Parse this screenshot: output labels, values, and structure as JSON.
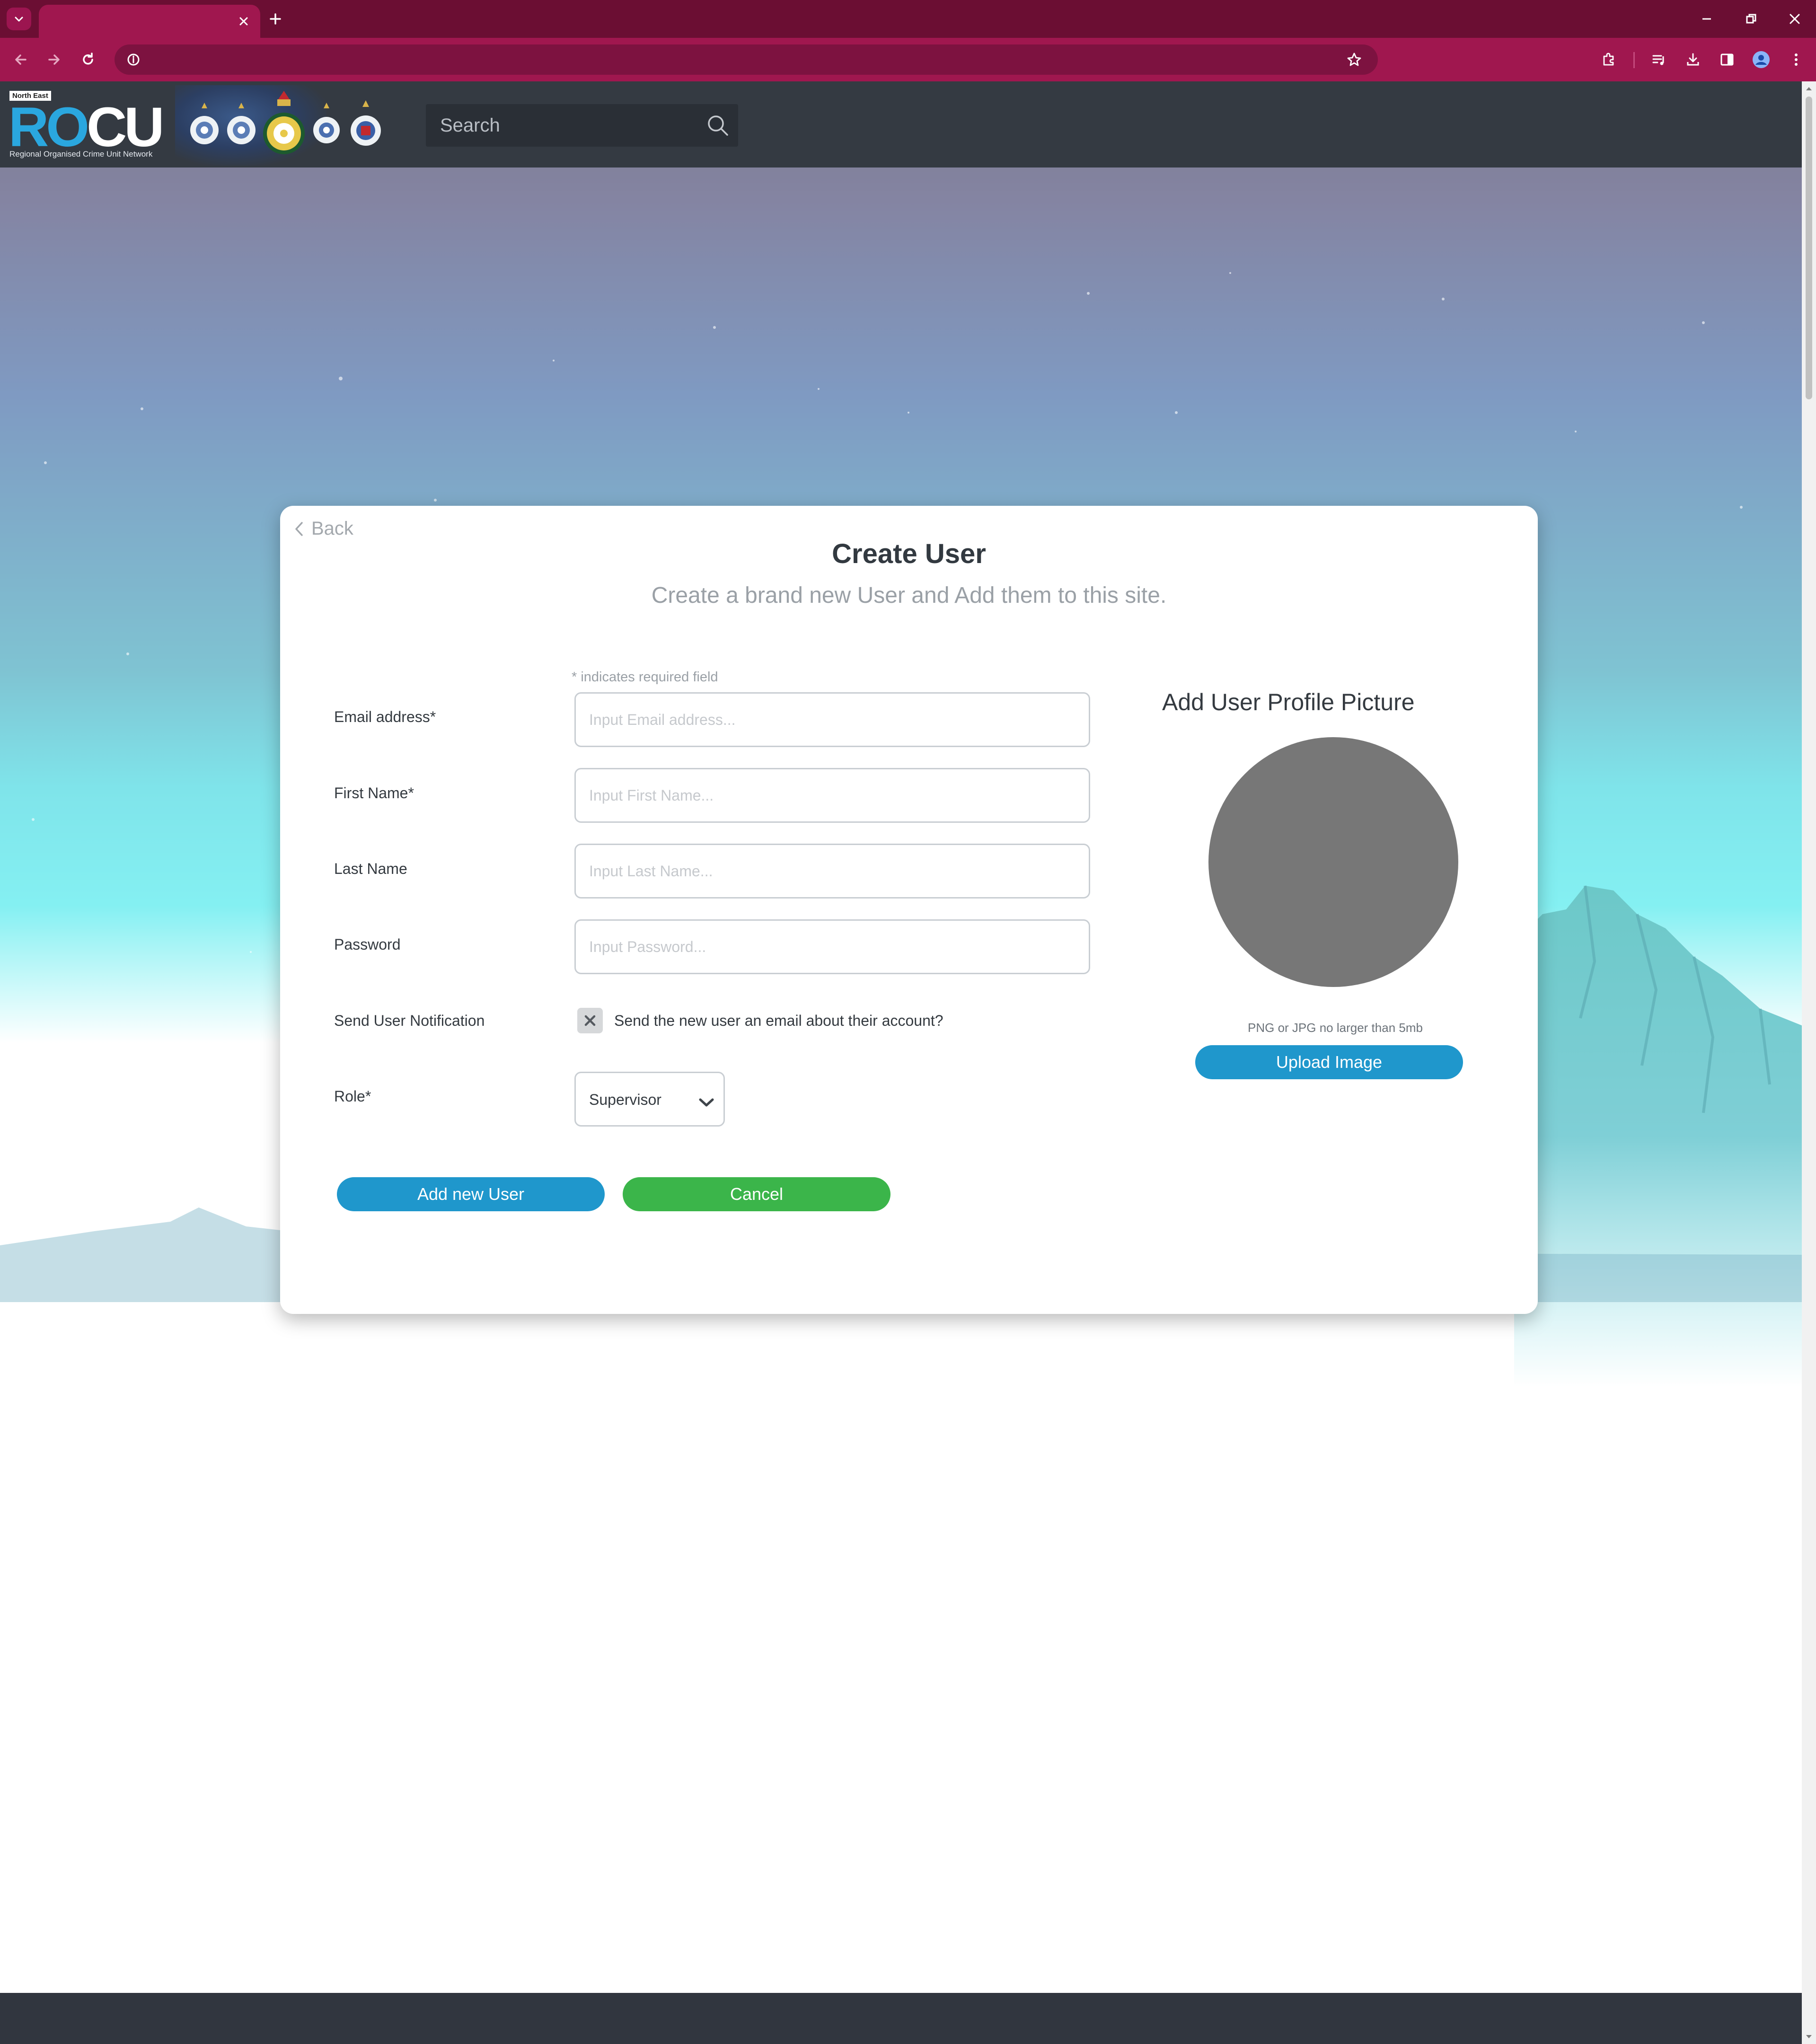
{
  "browser": {
    "tab_title": "",
    "address": ""
  },
  "header": {
    "logo": {
      "tag": "North East",
      "word_r": "R",
      "word_o": "O",
      "word_cu": "CU",
      "subtitle": "Regional Organised Crime Unit Network"
    },
    "search_placeholder": "Search"
  },
  "form": {
    "back_label": "Back",
    "title": "Create User",
    "subtitle": "Create a brand new User and Add them to this site.",
    "required_note": "* indicates required field",
    "fields": {
      "email": {
        "label": "Email address*",
        "placeholder": "Input Email address...",
        "value": ""
      },
      "first_name": {
        "label": "First Name*",
        "placeholder": "Input First Name...",
        "value": ""
      },
      "last_name": {
        "label": "Last Name",
        "placeholder": "Input Last Name...",
        "value": ""
      },
      "password": {
        "label": "Password",
        "placeholder": "Input Password...",
        "value": ""
      }
    },
    "notification": {
      "label": "Send User Notification",
      "checkbox_text": "Send the new user an email about their account?",
      "checked": false
    },
    "role": {
      "label": "Role*",
      "selected": "Supervisor"
    },
    "add_button": "Add new User",
    "cancel_button": "Cancel"
  },
  "profile_picture": {
    "title": "Add User Profile Picture",
    "hint": "PNG or JPG no larger than 5mb",
    "upload_button": "Upload Image"
  },
  "colors": {
    "chrome_dark": "#6b0e33",
    "chrome_accent": "#a0174f",
    "header_bg": "#343a42",
    "primary_blue": "#1f97cc",
    "cancel_green": "#3bb54a",
    "avatar_gray": "#777777"
  }
}
